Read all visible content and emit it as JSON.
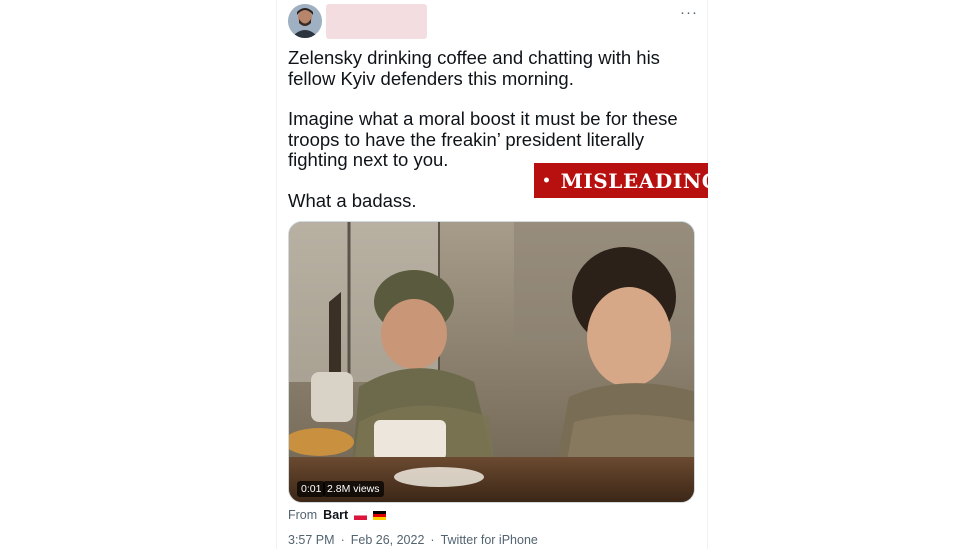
{
  "tweet": {
    "paragraphs": [
      "Zelensky drinking coffee and chatting with his fellow Kyiv defenders this morning.",
      "Imagine what a moral boost it must be for these troops to have the freakin’ president literally fighting next to you.",
      "What a badass."
    ],
    "more_icon": "more-dots-icon",
    "more_glyph": "···"
  },
  "badge": {
    "dot": "•",
    "label": "MISLEADING",
    "color": "#b80f0f"
  },
  "video": {
    "time": "0:01",
    "views": "2.8M views"
  },
  "from": {
    "prefix": "From",
    "name": "Bart",
    "flags": [
      "poland-flag-icon",
      "germany-flag-icon"
    ]
  },
  "meta": {
    "time": "3:57 PM",
    "date": "Feb 26, 2022",
    "source": "Twitter for iPhone",
    "sep": "·"
  }
}
